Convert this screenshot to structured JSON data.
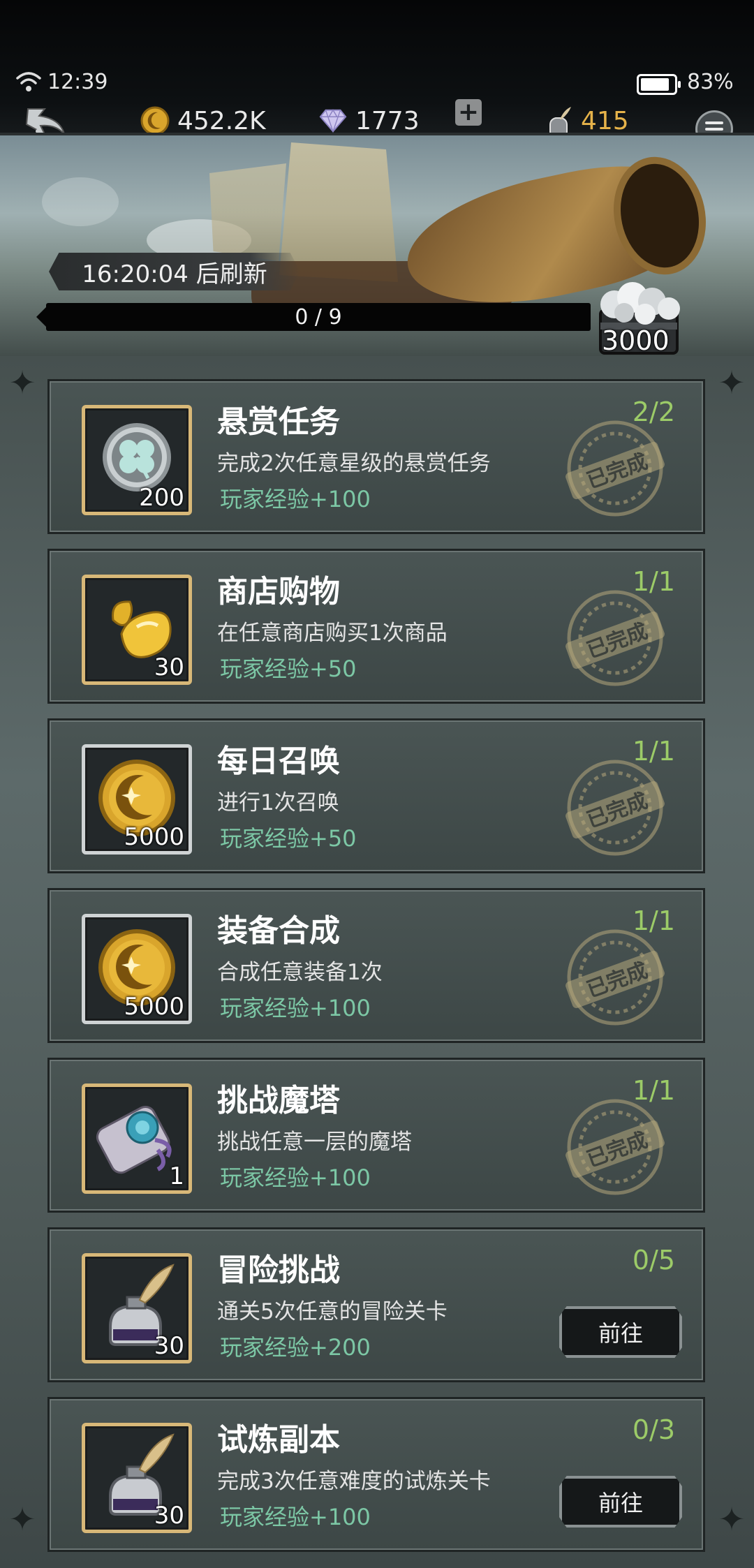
{
  "status": {
    "time": "12:39",
    "battery": "83%",
    "battery_level": 0.83
  },
  "header": {
    "gold": "452.2K",
    "gems": "1773",
    "ink": "415"
  },
  "banner": {
    "refresh_text": "16:20:04 后刷新",
    "progress_text": "0 / 9",
    "progress_value": 0,
    "progress_max": 9,
    "chest_count": "3000"
  },
  "tasks": [
    {
      "title": "悬赏任务",
      "desc": "完成2次任意星级的悬赏任务",
      "reward": "玩家经验+100",
      "count": "2/2",
      "qty": "200",
      "icon": "clover-token-icon",
      "state": "completed",
      "stamp": "已完成"
    },
    {
      "title": "商店购物",
      "desc": "在任意商店购买1次商品",
      "reward": "玩家经验+50",
      "count": "1/1",
      "qty": "30",
      "icon": "gold-bean-icon",
      "state": "completed",
      "stamp": "已完成"
    },
    {
      "title": "每日召唤",
      "desc": "进行1次召唤",
      "reward": "玩家经验+50",
      "count": "1/1",
      "qty": "5000",
      "icon": "gold-coin-icon",
      "state": "completed",
      "stamp": "已完成"
    },
    {
      "title": "装备合成",
      "desc": "合成任意装备1次",
      "reward": "玩家经验+100",
      "count": "1/1",
      "qty": "5000",
      "icon": "gold-coin-icon",
      "state": "completed",
      "stamp": "已完成"
    },
    {
      "title": "挑战魔塔",
      "desc": "挑战任意一层的魔塔",
      "reward": "玩家经验+100",
      "count": "1/1",
      "qty": "1",
      "icon": "scroll-icon",
      "state": "completed",
      "stamp": "已完成"
    },
    {
      "title": "冒险挑战",
      "desc": "通关5次任意的冒险关卡",
      "reward": "玩家经验+200",
      "count": "0/5",
      "qty": "30",
      "icon": "ink-bottle-icon",
      "state": "pending",
      "button": "前往"
    },
    {
      "title": "试炼副本",
      "desc": "完成3次任意难度的试炼关卡",
      "reward": "玩家经验+100",
      "count": "0/3",
      "qty": "30",
      "icon": "ink-bottle-icon",
      "state": "pending",
      "button": "前往"
    }
  ],
  "colors": {
    "count_text": "#9ccb68",
    "reward_text": "#7cc7a5",
    "ink_text": "#e6b34a",
    "frame_gold": "#d8b878"
  }
}
